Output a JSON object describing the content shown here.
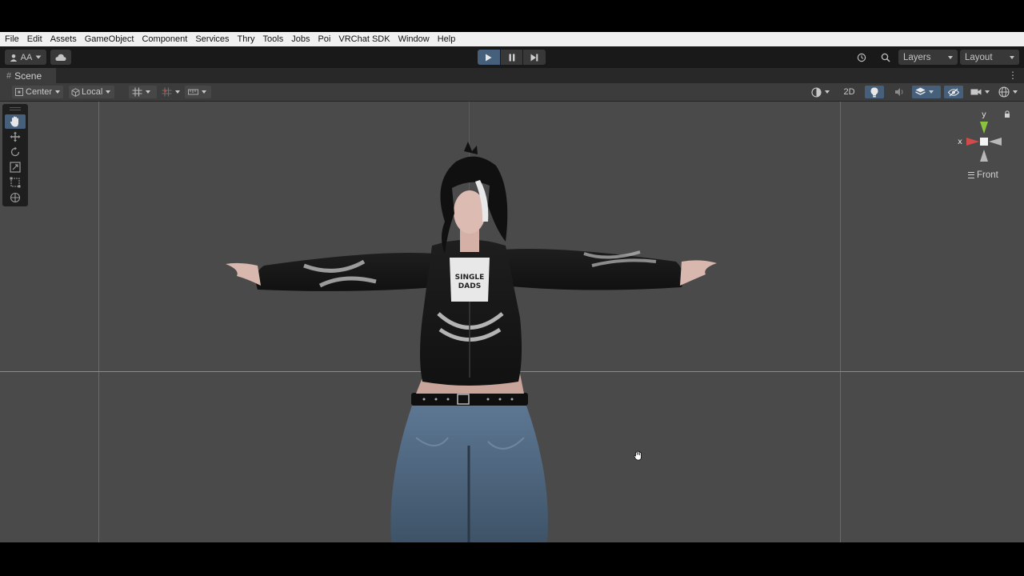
{
  "menu": {
    "items": [
      "File",
      "Edit",
      "Assets",
      "GameObject",
      "Component",
      "Services",
      "Thry",
      "Tools",
      "Jobs",
      "Poi",
      "VRChat SDK",
      "Window",
      "Help"
    ]
  },
  "toolbar": {
    "account_label": "AA",
    "account_icon": "user-icon",
    "cloud_icon": "cloud-icon",
    "play_icon": "play-icon",
    "pause_icon": "pause-icon",
    "step_icon": "step-icon",
    "history_icon": "history-icon",
    "search_icon": "search-icon",
    "layers_label": "Layers",
    "layout_label": "Layout"
  },
  "scene_tab": {
    "label": "Scene",
    "icon": "hash-icon"
  },
  "scene_toolbar": {
    "pivot_label": "Center",
    "space_label": "Local",
    "mode_2d_label": "2D"
  },
  "tools": [
    "hand-tool",
    "move-tool",
    "rotate-tool",
    "scale-tool",
    "rect-tool",
    "transform-tool"
  ],
  "gizmo": {
    "y_label": "y",
    "x_label": "x",
    "view_label": "Front"
  },
  "colors": {
    "accent": "#46607c",
    "gizmo_y": "#8ac33c",
    "gizmo_x": "#d24b4b",
    "viewport": "#4a4a4a"
  }
}
